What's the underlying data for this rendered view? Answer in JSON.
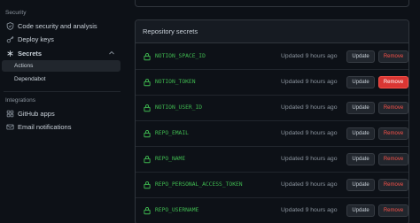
{
  "sidebar": {
    "security_title": "Security",
    "items": [
      {
        "label": "Code security and analysis",
        "icon": "shield-check-icon"
      },
      {
        "label": "Deploy keys",
        "icon": "key-icon"
      },
      {
        "label": "Secrets",
        "icon": "asterisk-icon"
      }
    ],
    "sub_items": [
      {
        "label": "Actions",
        "active": true
      },
      {
        "label": "Dependabot",
        "active": false
      }
    ],
    "integrations_title": "Integrations",
    "integration_items": [
      {
        "label": "GitHub apps",
        "icon": "apps-icon"
      },
      {
        "label": "Email notifications",
        "icon": "mail-icon"
      }
    ]
  },
  "panel": {
    "title": "Repository secrets",
    "update_label": "Update",
    "remove_label": "Remove",
    "secrets": [
      {
        "name": "NOTION_SPACE_ID",
        "updated": "Updated 9 hours ago"
      },
      {
        "name": "NOTION_TOKEN",
        "updated": "Updated 9 hours ago",
        "remove_hover": true
      },
      {
        "name": "NOTION_USER_ID",
        "updated": "Updated 9 hours ago"
      },
      {
        "name": "REPO_EMAIL",
        "updated": "Updated 9 hours ago"
      },
      {
        "name": "REPO_NAME",
        "updated": "Updated 9 hours ago"
      },
      {
        "name": "REPO_PERSONAL_ACCESS_TOKEN",
        "updated": "Updated 9 hours ago"
      },
      {
        "name": "REPO_USERNAME",
        "updated": "Updated 9 hours ago"
      }
    ]
  },
  "colors": {
    "background": "#0d1117",
    "secret_name": "#3fb950",
    "remove_danger": "#da3633"
  }
}
